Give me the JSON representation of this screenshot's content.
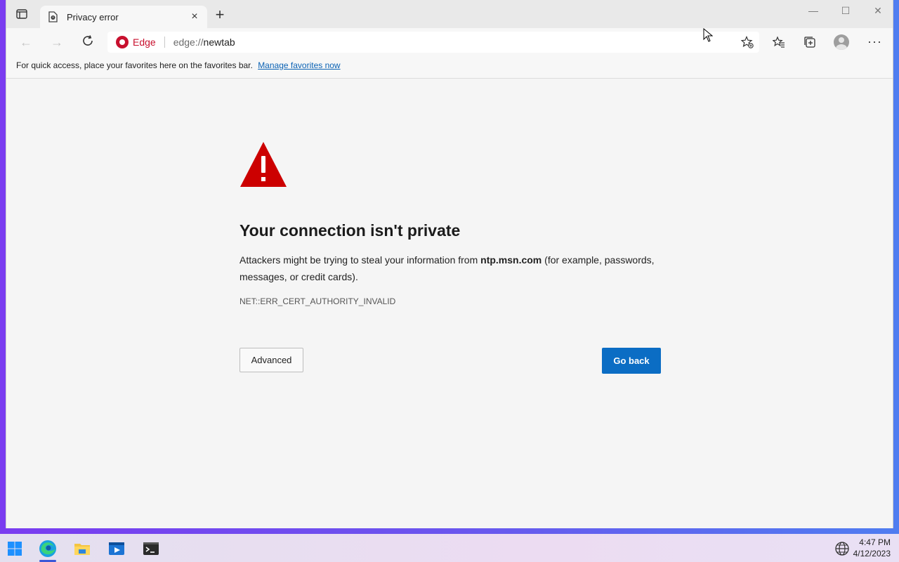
{
  "browser": {
    "tab_title": "Privacy error",
    "brand_label": "Edge",
    "url_scheme": "edge://",
    "url_rest": "newtab",
    "window_controls": {
      "minimize": "—",
      "maximize": "☐",
      "close": "✕"
    }
  },
  "favorites_bar": {
    "message": "For quick access, place your favorites here on the favorites bar.",
    "link": "Manage favorites now"
  },
  "error_page": {
    "heading": "Your connection isn't private",
    "desc_prefix": "Attackers might be trying to steal your information from ",
    "host": "ntp.msn.com",
    "desc_suffix": " (for example, passwords, messages, or credit cards).",
    "error_code": "NET::ERR_CERT_AUTHORITY_INVALID",
    "advanced_button": "Advanced",
    "back_button": "Go back"
  },
  "taskbar": {
    "time": "4:47 PM",
    "date": "4/12/2023"
  },
  "colors": {
    "accent_blue": "#0b6dc4",
    "warning_red": "#c8102e"
  }
}
